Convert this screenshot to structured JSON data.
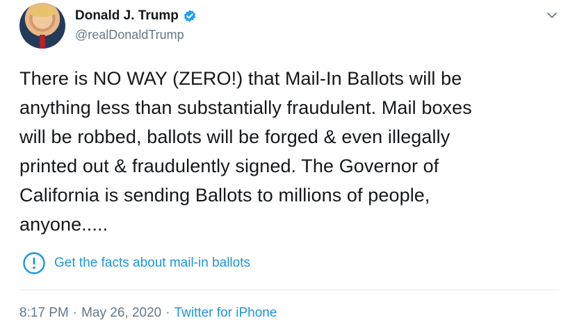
{
  "author": {
    "display_name": "Donald J. Trump",
    "handle": "@realDonaldTrump",
    "avatar_icon": "profile-photo",
    "verified_icon": "verified-badge-icon"
  },
  "tweet": {
    "lines": [
      "There is NO WAY (ZERO!) that Mail-In Ballots will be",
      "anything less than substantially fraudulent. Mail boxes",
      "will be robbed, ballots will be forged & even illegally",
      "printed out & fraudulently signed. The Governor of",
      "California is sending Ballots to millions of people,",
      "anyone....."
    ]
  },
  "fact_check": {
    "label": "Get the facts about mail-in ballots",
    "icon": "exclamation-circle-icon"
  },
  "meta": {
    "time": "8:17 PM",
    "separator_1": "·",
    "date": "May 26, 2020",
    "separator_2": "·",
    "source": "Twitter for iPhone"
  },
  "colors": {
    "text": "#14171a",
    "muted": "#657786",
    "link": "#1b95e0",
    "verified": "#1da1f2",
    "divider": "#e1e8ed"
  }
}
